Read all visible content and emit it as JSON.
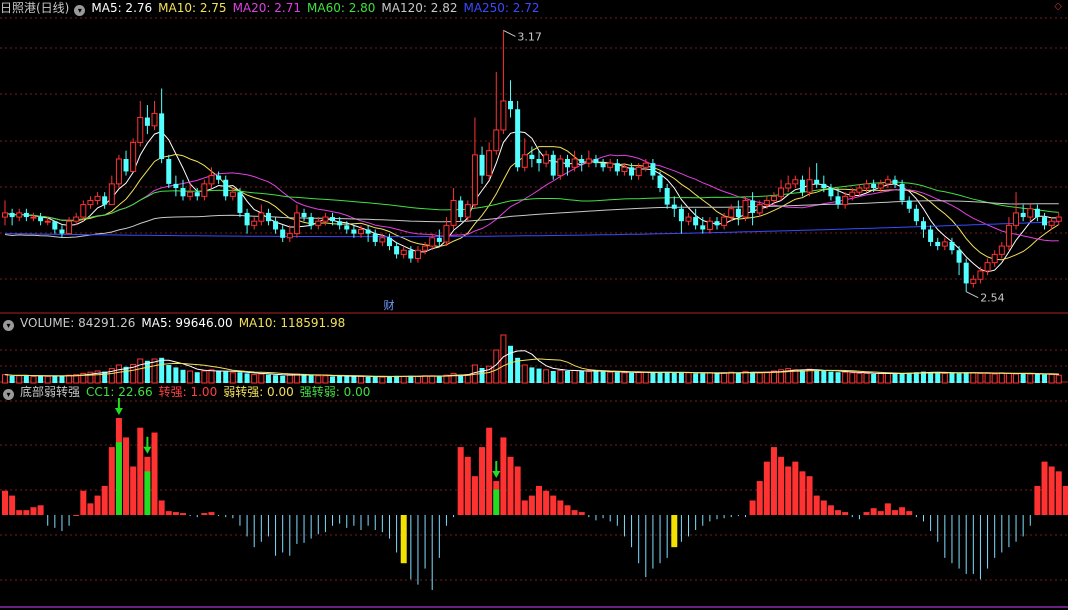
{
  "main_header": {
    "title": "日照港(日线)",
    "items": [
      {
        "label": "MA5: 2.76",
        "color": "#ffffff"
      },
      {
        "label": "MA10: 2.75",
        "color": "#f2e05a"
      },
      {
        "label": "MA20: 2.71",
        "color": "#e040e0"
      },
      {
        "label": "MA60: 2.80",
        "color": "#40e040"
      },
      {
        "label": "MA120: 2.82",
        "color": "#c8c8c8"
      },
      {
        "label": "MA250: 2.72",
        "color": "#3a4aff"
      }
    ]
  },
  "volume_header": {
    "items": [
      {
        "label": "VOLUME: 84291.26",
        "color": "#c8c8c8"
      },
      {
        "label": "MA5: 99646.00",
        "color": "#ffffff"
      },
      {
        "label": "MA10: 118591.98",
        "color": "#f2e05a"
      }
    ]
  },
  "indicator_header": {
    "title": "底部弱转强",
    "items": [
      {
        "label": "CC1: 22.66",
        "color": "#40e040"
      },
      {
        "label": "转强: 1.00",
        "color": "#ff4040"
      },
      {
        "label": "弱转强: 0.00",
        "color": "#f2e05a"
      },
      {
        "label": "强转弱: 0.00",
        "color": "#40e040"
      }
    ]
  },
  "annotations": {
    "high_label": "3.17",
    "low_label": "2.54",
    "event_marker": "财"
  },
  "colors": {
    "up": "#ff3232",
    "down": "#54ffff",
    "grid": "#781e1e",
    "divider": "#b02020",
    "green_bar": "#22dd22",
    "yellow_bar": "#f2e000"
  },
  "chart_data": [
    {
      "type": "candlestick",
      "title": "日照港(日线)",
      "ylim": [
        2.54,
        3.17
      ],
      "annotations": [
        {
          "label": "3.17",
          "value": 3.17,
          "kind": "high"
        },
        {
          "label": "2.54",
          "value": 2.54,
          "kind": "low"
        }
      ],
      "candles": [
        [
          2.72,
          2.73,
          2.7,
          2.76
        ],
        [
          2.73,
          2.72,
          2.7,
          2.74
        ],
        [
          2.72,
          2.73,
          2.71,
          2.74
        ],
        [
          2.73,
          2.72,
          2.71,
          2.74
        ],
        [
          2.72,
          2.72,
          2.71,
          2.73
        ],
        [
          2.72,
          2.71,
          2.7,
          2.73
        ],
        [
          2.71,
          2.71,
          2.7,
          2.72
        ],
        [
          2.71,
          2.69,
          2.68,
          2.71
        ],
        [
          2.69,
          2.68,
          2.67,
          2.7
        ],
        [
          2.68,
          2.71,
          2.68,
          2.72
        ],
        [
          2.71,
          2.72,
          2.7,
          2.73
        ],
        [
          2.72,
          2.75,
          2.71,
          2.76
        ],
        [
          2.75,
          2.76,
          2.74,
          2.77
        ],
        [
          2.76,
          2.77,
          2.75,
          2.78
        ],
        [
          2.77,
          2.75,
          2.74,
          2.78
        ],
        [
          2.75,
          2.8,
          2.75,
          2.82
        ],
        [
          2.8,
          2.86,
          2.79,
          2.87
        ],
        [
          2.86,
          2.83,
          2.82,
          2.88
        ],
        [
          2.83,
          2.9,
          2.83,
          2.91
        ],
        [
          2.9,
          2.96,
          2.89,
          3.0
        ],
        [
          2.96,
          2.94,
          2.92,
          2.99
        ],
        [
          2.94,
          2.97,
          2.93,
          3.0
        ],
        [
          2.97,
          2.86,
          2.85,
          3.03
        ],
        [
          2.86,
          2.8,
          2.79,
          2.87
        ],
        [
          2.8,
          2.79,
          2.77,
          2.82
        ],
        [
          2.79,
          2.77,
          2.76,
          2.81
        ],
        [
          2.77,
          2.78,
          2.76,
          2.8
        ],
        [
          2.78,
          2.77,
          2.76,
          2.79
        ],
        [
          2.77,
          2.8,
          2.76,
          2.81
        ],
        [
          2.8,
          2.82,
          2.79,
          2.84
        ],
        [
          2.82,
          2.81,
          2.8,
          2.83
        ],
        [
          2.81,
          2.77,
          2.76,
          2.82
        ],
        [
          2.77,
          2.78,
          2.76,
          2.79
        ],
        [
          2.78,
          2.73,
          2.72,
          2.79
        ],
        [
          2.73,
          2.7,
          2.68,
          2.74
        ],
        [
          2.7,
          2.71,
          2.69,
          2.72
        ],
        [
          2.71,
          2.73,
          2.7,
          2.75
        ],
        [
          2.73,
          2.71,
          2.7,
          2.74
        ],
        [
          2.71,
          2.69,
          2.68,
          2.72
        ],
        [
          2.69,
          2.67,
          2.66,
          2.7
        ],
        [
          2.67,
          2.68,
          2.66,
          2.7
        ],
        [
          2.68,
          2.73,
          2.67,
          2.75
        ],
        [
          2.73,
          2.72,
          2.71,
          2.74
        ],
        [
          2.72,
          2.7,
          2.69,
          2.73
        ],
        [
          2.7,
          2.71,
          2.69,
          2.72
        ],
        [
          2.71,
          2.72,
          2.7,
          2.73
        ],
        [
          2.72,
          2.71,
          2.7,
          2.73
        ],
        [
          2.71,
          2.7,
          2.69,
          2.72
        ],
        [
          2.7,
          2.69,
          2.68,
          2.71
        ],
        [
          2.69,
          2.68,
          2.67,
          2.7
        ],
        [
          2.68,
          2.69,
          2.67,
          2.7
        ],
        [
          2.69,
          2.68,
          2.66,
          2.7
        ],
        [
          2.68,
          2.66,
          2.65,
          2.69
        ],
        [
          2.66,
          2.67,
          2.65,
          2.68
        ],
        [
          2.67,
          2.65,
          2.64,
          2.68
        ],
        [
          2.65,
          2.63,
          2.62,
          2.66
        ],
        [
          2.63,
          2.64,
          2.62,
          2.65
        ],
        [
          2.64,
          2.62,
          2.61,
          2.65
        ],
        [
          2.62,
          2.64,
          2.61,
          2.65
        ],
        [
          2.64,
          2.65,
          2.63,
          2.66
        ],
        [
          2.65,
          2.67,
          2.64,
          2.68
        ],
        [
          2.67,
          2.66,
          2.65,
          2.69
        ],
        [
          2.66,
          2.7,
          2.65,
          2.72
        ],
        [
          2.7,
          2.76,
          2.69,
          2.79
        ],
        [
          2.76,
          2.72,
          2.71,
          2.77
        ],
        [
          2.72,
          2.75,
          2.71,
          2.76
        ],
        [
          2.75,
          2.87,
          2.74,
          2.96
        ],
        [
          2.87,
          2.82,
          2.8,
          2.89
        ],
        [
          2.82,
          2.88,
          2.81,
          2.9
        ],
        [
          2.88,
          2.93,
          2.87,
          3.07
        ],
        [
          2.93,
          3.0,
          2.92,
          3.17
        ],
        [
          3.0,
          2.98,
          2.96,
          3.05
        ],
        [
          2.98,
          2.84,
          2.83,
          3.0
        ],
        [
          2.84,
          2.87,
          2.83,
          2.91
        ],
        [
          2.87,
          2.86,
          2.84,
          2.89
        ],
        [
          2.86,
          2.85,
          2.83,
          2.88
        ],
        [
          2.85,
          2.87,
          2.84,
          2.88
        ],
        [
          2.87,
          2.82,
          2.81,
          2.88
        ],
        [
          2.82,
          2.86,
          2.81,
          2.87
        ],
        [
          2.86,
          2.84,
          2.82,
          2.87
        ],
        [
          2.84,
          2.86,
          2.83,
          2.88
        ],
        [
          2.86,
          2.85,
          2.83,
          2.87
        ],
        [
          2.85,
          2.86,
          2.84,
          2.88
        ],
        [
          2.86,
          2.85,
          2.84,
          2.87
        ],
        [
          2.85,
          2.84,
          2.83,
          2.86
        ],
        [
          2.84,
          2.85,
          2.83,
          2.86
        ],
        [
          2.85,
          2.83,
          2.82,
          2.86
        ],
        [
          2.83,
          2.84,
          2.82,
          2.85
        ],
        [
          2.84,
          2.82,
          2.81,
          2.85
        ],
        [
          2.82,
          2.84,
          2.81,
          2.85
        ],
        [
          2.84,
          2.85,
          2.83,
          2.86
        ],
        [
          2.85,
          2.82,
          2.81,
          2.86
        ],
        [
          2.82,
          2.79,
          2.78,
          2.83
        ],
        [
          2.79,
          2.75,
          2.74,
          2.8
        ],
        [
          2.75,
          2.74,
          2.72,
          2.77
        ],
        [
          2.74,
          2.71,
          2.68,
          2.75
        ],
        [
          2.71,
          2.72,
          2.7,
          2.73
        ],
        [
          2.72,
          2.7,
          2.69,
          2.74
        ],
        [
          2.7,
          2.69,
          2.68,
          2.72
        ],
        [
          2.69,
          2.71,
          2.68,
          2.72
        ],
        [
          2.71,
          2.7,
          2.69,
          2.72
        ],
        [
          2.7,
          2.72,
          2.69,
          2.73
        ],
        [
          2.72,
          2.74,
          2.71,
          2.75
        ],
        [
          2.74,
          2.72,
          2.7,
          2.76
        ],
        [
          2.72,
          2.76,
          2.71,
          2.77
        ],
        [
          2.76,
          2.73,
          2.7,
          2.78
        ],
        [
          2.73,
          2.75,
          2.72,
          2.76
        ],
        [
          2.75,
          2.76,
          2.74,
          2.77
        ],
        [
          2.76,
          2.77,
          2.75,
          2.78
        ],
        [
          2.77,
          2.79,
          2.76,
          2.81
        ],
        [
          2.79,
          2.8,
          2.78,
          2.82
        ],
        [
          2.8,
          2.81,
          2.79,
          2.82
        ],
        [
          2.81,
          2.78,
          2.77,
          2.82
        ],
        [
          2.78,
          2.81,
          2.77,
          2.84
        ],
        [
          2.81,
          2.8,
          2.79,
          2.85
        ],
        [
          2.8,
          2.79,
          2.78,
          2.82
        ],
        [
          2.79,
          2.77,
          2.76,
          2.8
        ],
        [
          2.77,
          2.75,
          2.74,
          2.79
        ],
        [
          2.75,
          2.77,
          2.74,
          2.78
        ],
        [
          2.77,
          2.78,
          2.76,
          2.79
        ],
        [
          2.78,
          2.79,
          2.77,
          2.8
        ],
        [
          2.79,
          2.8,
          2.78,
          2.81
        ],
        [
          2.8,
          2.79,
          2.78,
          2.81
        ],
        [
          2.79,
          2.8,
          2.78,
          2.81
        ],
        [
          2.8,
          2.81,
          2.79,
          2.82
        ],
        [
          2.81,
          2.8,
          2.79,
          2.82
        ],
        [
          2.8,
          2.76,
          2.75,
          2.81
        ],
        [
          2.76,
          2.74,
          2.73,
          2.77
        ],
        [
          2.74,
          2.71,
          2.7,
          2.75
        ],
        [
          2.71,
          2.69,
          2.67,
          2.72
        ],
        [
          2.69,
          2.66,
          2.65,
          2.7
        ],
        [
          2.66,
          2.65,
          2.64,
          2.67
        ],
        [
          2.65,
          2.66,
          2.64,
          2.67
        ],
        [
          2.66,
          2.64,
          2.63,
          2.67
        ],
        [
          2.64,
          2.61,
          2.58,
          2.65
        ],
        [
          2.61,
          2.56,
          2.54,
          2.62
        ],
        [
          2.56,
          2.57,
          2.55,
          2.58
        ],
        [
          2.57,
          2.59,
          2.56,
          2.6
        ],
        [
          2.59,
          2.61,
          2.58,
          2.62
        ],
        [
          2.61,
          2.63,
          2.6,
          2.64
        ],
        [
          2.63,
          2.65,
          2.62,
          2.66
        ],
        [
          2.65,
          2.7,
          2.64,
          2.72
        ],
        [
          2.7,
          2.73,
          2.69,
          2.78
        ],
        [
          2.73,
          2.72,
          2.71,
          2.75
        ],
        [
          2.72,
          2.74,
          2.71,
          2.75
        ],
        [
          2.74,
          2.72,
          2.71,
          2.75
        ],
        [
          2.72,
          2.7,
          2.69,
          2.73
        ],
        [
          2.7,
          2.71,
          2.69,
          2.72
        ],
        [
          2.71,
          2.72,
          2.7,
          2.73
        ]
      ],
      "series": [
        {
          "name": "MA5",
          "color": "#ffffff"
        },
        {
          "name": "MA10",
          "color": "#f2e05a"
        },
        {
          "name": "MA20",
          "color": "#e040e0"
        },
        {
          "name": "MA60",
          "color": "#40e040"
        },
        {
          "name": "MA120",
          "color": "#c8c8c8"
        },
        {
          "name": "MA250",
          "color": "#3a4aff"
        }
      ]
    },
    {
      "type": "bar",
      "title": "VOLUME",
      "ylim": [
        0,
        85
      ],
      "values": [
        14,
        12,
        12,
        13,
        11,
        12,
        11,
        12,
        12,
        13,
        14,
        16,
        18,
        20,
        19,
        24,
        30,
        27,
        31,
        40,
        37,
        40,
        42,
        30,
        26,
        22,
        20,
        18,
        20,
        22,
        20,
        19,
        17,
        18,
        16,
        14,
        15,
        14,
        13,
        12,
        13,
        15,
        14,
        13,
        12,
        12,
        11,
        12,
        11,
        11,
        11,
        10,
        11,
        10,
        11,
        12,
        11,
        12,
        11,
        12,
        12,
        11,
        13,
        16,
        14,
        14,
        30,
        25,
        28,
        55,
        80,
        62,
        42,
        30,
        26,
        24,
        22,
        20,
        21,
        20,
        21,
        20,
        19,
        20,
        19,
        18,
        18,
        17,
        17,
        18,
        18,
        17,
        18,
        18,
        17,
        18,
        17,
        16,
        16,
        17,
        16,
        17,
        18,
        17,
        19,
        18,
        17,
        18,
        20,
        22,
        24,
        22,
        21,
        23,
        21,
        20,
        19,
        18,
        18,
        17,
        16,
        16,
        15,
        16,
        16,
        16,
        16,
        17,
        18,
        19,
        18,
        17,
        16,
        17,
        16,
        18,
        17,
        16,
        16,
        15,
        17,
        16,
        15,
        16,
        15,
        15,
        14,
        14,
        13
      ]
    },
    {
      "type": "bar",
      "title": "底部弱转强",
      "ylim": [
        -70,
        100
      ],
      "values": [
        25,
        20,
        5,
        5,
        8,
        10,
        -10,
        -12,
        -15,
        -10,
        0,
        25,
        12,
        20,
        30,
        70,
        100,
        80,
        50,
        90,
        60,
        85,
        15,
        4,
        3,
        2,
        -1,
        -2,
        2,
        3,
        -1,
        -2,
        -3,
        -10,
        -20,
        -30,
        -25,
        -20,
        -38,
        -35,
        -38,
        -27,
        -26,
        -22,
        -18,
        -16,
        -10,
        -8,
        -12,
        -10,
        -14,
        -10,
        -14,
        -16,
        -22,
        -35,
        -45,
        -60,
        -65,
        -50,
        -70,
        -40,
        -10,
        -2,
        70,
        60,
        40,
        70,
        90,
        35,
        80,
        60,
        50,
        15,
        20,
        30,
        25,
        20,
        15,
        10,
        5,
        3,
        -2,
        -5,
        -3,
        -6,
        -10,
        -20,
        -30,
        -45,
        -58,
        -50,
        -45,
        -40,
        -30,
        -25,
        -20,
        -14,
        -10,
        -6,
        -4,
        -3,
        -2,
        -1,
        -2,
        15,
        35,
        55,
        70,
        60,
        50,
        55,
        45,
        40,
        20,
        15,
        10,
        5,
        3,
        -2,
        -4,
        3,
        7,
        4,
        12,
        5,
        8,
        4,
        -2,
        -6,
        -15,
        -25,
        -40,
        -45,
        -50,
        -55,
        -55,
        -60,
        -50,
        -40,
        -35,
        -30,
        -25,
        -20,
        -10,
        30,
        55,
        50,
        45,
        30,
        15,
        15,
        15
      ],
      "highlights": [
        {
          "index": 16,
          "color": "green",
          "arrow": true
        },
        {
          "index": 20,
          "color": "green",
          "arrow": true
        },
        {
          "index": 69,
          "color": "green",
          "arrow": true
        },
        {
          "index": 56,
          "color": "yellow"
        },
        {
          "index": 94,
          "color": "yellow"
        }
      ]
    }
  ]
}
